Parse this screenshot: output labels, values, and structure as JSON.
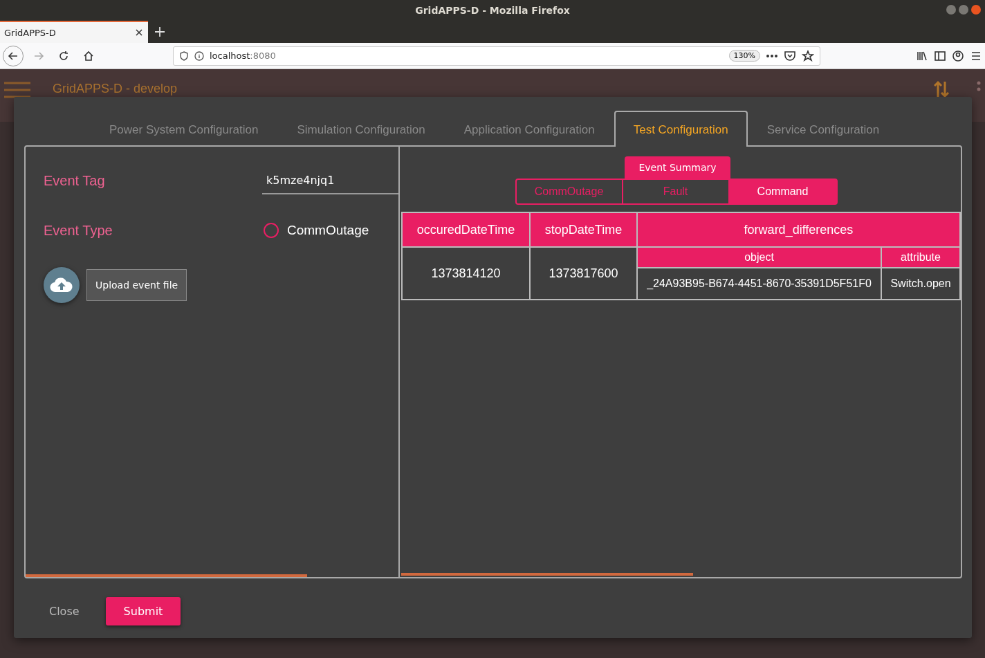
{
  "browser": {
    "window_title": "GridAPPS-D - Mozilla Firefox",
    "tab": {
      "title": "GridAPPS-D"
    },
    "url": {
      "host": "localhost",
      "port": ":8080"
    },
    "zoom": "130%"
  },
  "app_bar": {
    "title": "GridAPPS-D - develop"
  },
  "dialog": {
    "tabs": [
      {
        "label": "Power System Configuration",
        "selected": false
      },
      {
        "label": "Simulation Configuration",
        "selected": false
      },
      {
        "label": "Application Configuration",
        "selected": false
      },
      {
        "label": "Test Configuration",
        "selected": true
      },
      {
        "label": "Service Configuration",
        "selected": false
      }
    ],
    "form": {
      "event_tag": {
        "label": "Event Tag",
        "value": "k5mze4njq1"
      },
      "event_type": {
        "label": "Event Type",
        "options": [
          {
            "label": "CommOutage",
            "selected": false
          }
        ]
      },
      "upload": {
        "tooltip": "Upload event file"
      }
    },
    "summary": {
      "title": "Event Summary",
      "toggles": [
        {
          "label": "CommOutage",
          "selected": false
        },
        {
          "label": "Fault",
          "selected": false
        },
        {
          "label": "Command",
          "selected": true
        }
      ],
      "table": {
        "columns": [
          {
            "label": "occuredDateTime"
          },
          {
            "label": "stopDateTime"
          },
          {
            "label": "forward_differences",
            "colspan": 2
          }
        ],
        "subcolumns": [
          "object",
          "attribute"
        ],
        "rows": [
          [
            "1373814120",
            "1373817600",
            "_24A93B95-B674-4451-8670-35391D5F51F0",
            "Switch.open"
          ]
        ]
      }
    },
    "buttons": [
      {
        "label": "Close",
        "kind": "flat"
      },
      {
        "label": "Submit",
        "kind": "raised"
      }
    ]
  }
}
